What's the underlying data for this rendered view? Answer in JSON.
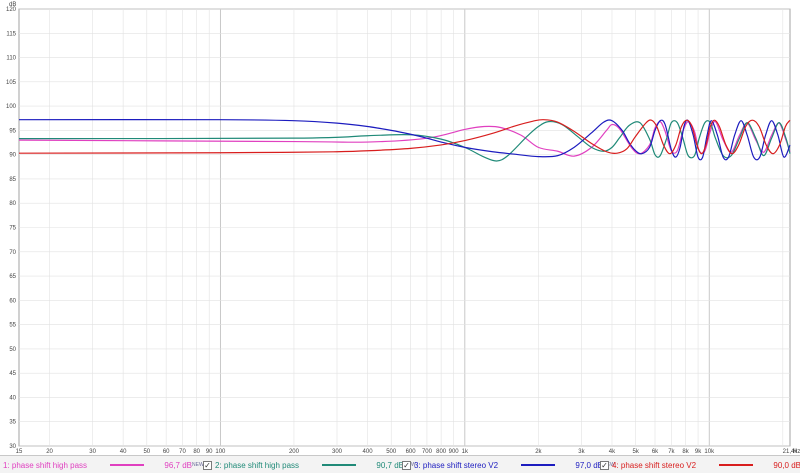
{
  "chart_data": {
    "type": "line",
    "ylabel": "dB",
    "xunit": "Hz",
    "xscale": "log",
    "xlim": [
      15,
      21400
    ],
    "ylim": [
      30,
      120
    ],
    "grid": true,
    "yticks": [
      30,
      35,
      40,
      45,
      50,
      55,
      60,
      65,
      70,
      75,
      80,
      85,
      90,
      95,
      100,
      105,
      110,
      115,
      120
    ],
    "xticks_major": [
      {
        "v": 15,
        "t": "15"
      },
      {
        "v": 20,
        "t": "20"
      },
      {
        "v": 30,
        "t": "30"
      },
      {
        "v": 40,
        "t": "40"
      },
      {
        "v": 50,
        "t": "50"
      },
      {
        "v": 60,
        "t": "60"
      },
      {
        "v": 70,
        "t": "70"
      },
      {
        "v": 80,
        "t": "80"
      },
      {
        "v": 90,
        "t": "90"
      },
      {
        "v": 100,
        "t": "100"
      },
      {
        "v": 200,
        "t": "200"
      },
      {
        "v": 300,
        "t": "300"
      },
      {
        "v": 400,
        "t": "400"
      },
      {
        "v": 500,
        "t": "500"
      },
      {
        "v": 600,
        "t": "600"
      },
      {
        "v": 700,
        "t": "700"
      },
      {
        "v": 800,
        "t": "800"
      },
      {
        "v": 900,
        "t": "900"
      },
      {
        "v": 1000,
        "t": "1k"
      },
      {
        "v": 2000,
        "t": "2k"
      },
      {
        "v": 3000,
        "t": "3k"
      },
      {
        "v": 4000,
        "t": "4k"
      },
      {
        "v": 5000,
        "t": "5k"
      },
      {
        "v": 6000,
        "t": "6k"
      },
      {
        "v": 7000,
        "t": "7k"
      },
      {
        "v": 8000,
        "t": "8k"
      },
      {
        "v": 9000,
        "t": "9k"
      },
      {
        "v": 10000,
        "t": "10k"
      },
      {
        "v": 21400,
        "t": "21,4k"
      }
    ],
    "series": [
      {
        "name": "1: phase shift  high pass",
        "color": "#e040c0",
        "value": "96,7 dB",
        "points": [
          [
            15,
            93
          ],
          [
            200,
            92.7
          ],
          [
            400,
            92.6
          ],
          [
            700,
            93.4
          ],
          [
            1000,
            95.2
          ],
          [
            1200,
            95.8
          ],
          [
            1400,
            95.6
          ],
          [
            1700,
            94
          ],
          [
            2000,
            91.5
          ],
          [
            2400,
            90.7
          ],
          [
            2800,
            89.7
          ],
          [
            3300,
            91.5
          ],
          [
            3800,
            95
          ],
          [
            4000,
            96.2
          ],
          [
            4300,
            95.3
          ],
          [
            4800,
            91.5
          ],
          [
            5200,
            90.2
          ],
          [
            5700,
            92
          ],
          [
            6000,
            95.5
          ],
          [
            6300,
            96.8
          ],
          [
            6600,
            94.8
          ],
          [
            7000,
            90.8
          ],
          [
            7400,
            90.8
          ],
          [
            7800,
            94.8
          ],
          [
            8200,
            96.8
          ],
          [
            8700,
            94.8
          ],
          [
            9100,
            90.8
          ],
          [
            9600,
            90.8
          ],
          [
            10100,
            94.8
          ],
          [
            10600,
            96.8
          ],
          [
            11400,
            93
          ],
          [
            12300,
            90.5
          ],
          [
            13300,
            94
          ],
          [
            14300,
            96.5
          ],
          [
            15500,
            93
          ],
          [
            16700,
            90.5
          ],
          [
            18000,
            94
          ],
          [
            19300,
            96.5
          ],
          [
            20600,
            93
          ],
          [
            21400,
            90.5
          ]
        ]
      },
      {
        "name": "2: phase shift  high pass",
        "color": "#208a78",
        "value": "90,7 dB",
        "points": [
          [
            15,
            93.3
          ],
          [
            200,
            93.4
          ],
          [
            400,
            93.9
          ],
          [
            600,
            94.1
          ],
          [
            800,
            93.2
          ],
          [
            1000,
            91.5
          ],
          [
            1200,
            89.5
          ],
          [
            1350,
            88.7
          ],
          [
            1500,
            89.8
          ],
          [
            1800,
            93.8
          ],
          [
            2000,
            95.8
          ],
          [
            2200,
            96.8
          ],
          [
            2500,
            96.2
          ],
          [
            2900,
            93.7
          ],
          [
            3300,
            91.5
          ],
          [
            3700,
            90.7
          ],
          [
            4000,
            91.5
          ],
          [
            4300,
            93.5
          ],
          [
            4700,
            96
          ],
          [
            5200,
            96.6
          ],
          [
            5700,
            93.2
          ],
          [
            6000,
            90
          ],
          [
            6300,
            89.8
          ],
          [
            6700,
            93.4
          ],
          [
            7000,
            96.6
          ],
          [
            7400,
            96.6
          ],
          [
            7800,
            93.4
          ],
          [
            8200,
            89.8
          ],
          [
            8700,
            89.8
          ],
          [
            9100,
            93.4
          ],
          [
            9600,
            96.6
          ],
          [
            10100,
            96.6
          ],
          [
            10600,
            93.4
          ],
          [
            11400,
            89.8
          ],
          [
            12300,
            89.8
          ],
          [
            13300,
            93.4
          ],
          [
            14300,
            96.6
          ],
          [
            15500,
            93.4
          ],
          [
            16700,
            89.8
          ],
          [
            18000,
            93.4
          ],
          [
            19300,
            96.6
          ],
          [
            20600,
            93.4
          ],
          [
            21400,
            90.2
          ]
        ]
      },
      {
        "name": "3: phase shift stereo V2",
        "color": "#1c1cbf",
        "value": "97,0 dB",
        "points": [
          [
            15,
            97.2
          ],
          [
            100,
            97.2
          ],
          [
            200,
            97
          ],
          [
            300,
            96.5
          ],
          [
            400,
            95.8
          ],
          [
            500,
            95
          ],
          [
            600,
            94.2
          ],
          [
            700,
            93.4
          ],
          [
            800,
            92.6
          ],
          [
            1000,
            91.5
          ],
          [
            1300,
            90.6
          ],
          [
            1600,
            90.1
          ],
          [
            2000,
            89.6
          ],
          [
            2400,
            89.8
          ],
          [
            2800,
            91.5
          ],
          [
            3300,
            94.5
          ],
          [
            3700,
            96.7
          ],
          [
            4000,
            97
          ],
          [
            4400,
            95
          ],
          [
            4700,
            92.5
          ],
          [
            5000,
            90.8
          ],
          [
            5300,
            90.2
          ],
          [
            5700,
            91.5
          ],
          [
            6000,
            95
          ],
          [
            6300,
            97
          ],
          [
            6600,
            96.2
          ],
          [
            7000,
            91
          ],
          [
            7300,
            89.5
          ],
          [
            7600,
            91.5
          ],
          [
            7900,
            96
          ],
          [
            8200,
            97
          ],
          [
            8600,
            94
          ],
          [
            9000,
            89.5
          ],
          [
            9400,
            89.5
          ],
          [
            9800,
            94
          ],
          [
            10200,
            97
          ],
          [
            10800,
            94
          ],
          [
            11400,
            89.5
          ],
          [
            12000,
            89.5
          ],
          [
            12700,
            94
          ],
          [
            13500,
            97
          ],
          [
            14300,
            94
          ],
          [
            15200,
            89.5
          ],
          [
            16100,
            89.5
          ],
          [
            17000,
            94
          ],
          [
            18000,
            97
          ],
          [
            19100,
            94
          ],
          [
            20200,
            89.5
          ],
          [
            21400,
            92
          ]
        ]
      },
      {
        "name": "4: phase shift stereo V2",
        "color": "#d81e1e",
        "value": "90,0 dB",
        "points": [
          [
            15,
            90.3
          ],
          [
            100,
            90.4
          ],
          [
            200,
            90.5
          ],
          [
            300,
            90.6
          ],
          [
            400,
            90.8
          ],
          [
            600,
            91.3
          ],
          [
            800,
            92
          ],
          [
            1000,
            92.9
          ],
          [
            1300,
            94.4
          ],
          [
            1600,
            95.9
          ],
          [
            1900,
            96.9
          ],
          [
            2100,
            97.2
          ],
          [
            2400,
            96.7
          ],
          [
            2800,
            94.8
          ],
          [
            3300,
            92.3
          ],
          [
            3800,
            90.6
          ],
          [
            4200,
            90.3
          ],
          [
            4600,
            91.2
          ],
          [
            5000,
            93.8
          ],
          [
            5500,
            96.5
          ],
          [
            5800,
            97.1
          ],
          [
            6100,
            95.8
          ],
          [
            6500,
            92
          ],
          [
            6900,
            90.2
          ],
          [
            7300,
            92
          ],
          [
            7700,
            95.8
          ],
          [
            8100,
            97.1
          ],
          [
            8500,
            95.8
          ],
          [
            8900,
            92
          ],
          [
            9300,
            90.2
          ],
          [
            9700,
            92
          ],
          [
            10100,
            95.8
          ],
          [
            10500,
            97.1
          ],
          [
            11000,
            95.8
          ],
          [
            11700,
            92
          ],
          [
            12400,
            90.2
          ],
          [
            13200,
            92
          ],
          [
            14100,
            95.8
          ],
          [
            15000,
            97.1
          ],
          [
            16000,
            95.8
          ],
          [
            17100,
            92
          ],
          [
            18200,
            90.2
          ],
          [
            19400,
            92
          ],
          [
            20500,
            95.8
          ],
          [
            21400,
            97.1
          ]
        ]
      }
    ]
  },
  "legend": {
    "sup": "NEW",
    "items": [
      {
        "label": "1: phase shift  high pass",
        "value": "96,7 dB",
        "color": "#e040c0",
        "checked": false
      },
      {
        "label": "2: phase shift  high pass",
        "value": "90,7 dB",
        "color": "#208a78",
        "checked": true
      },
      {
        "label": "3: phase shift stereo V2",
        "value": "97,0 dB",
        "color": "#1c1cbf",
        "checked": true
      },
      {
        "label": "4: phase shift stereo V2",
        "value": "90,0 dB",
        "color": "#d81e1e",
        "checked": true
      }
    ],
    "check_glyph": "✓"
  }
}
